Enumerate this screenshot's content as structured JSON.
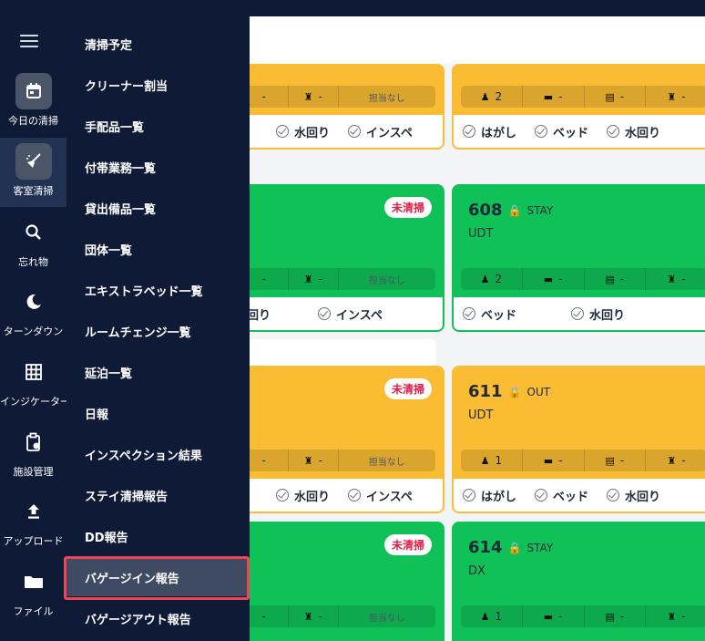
{
  "rail": {
    "items": [
      {
        "label": "今日の清掃",
        "icon": "calendar-icon"
      },
      {
        "label": "客室清掃",
        "icon": "broom-icon"
      },
      {
        "label": "忘れ物",
        "icon": "search-icon"
      },
      {
        "label": "ターンダウン",
        "icon": "moon-icon"
      },
      {
        "label": "インジケーター",
        "icon": "grid-icon"
      },
      {
        "label": "施設管理",
        "icon": "clipboard-icon"
      },
      {
        "label": "アップロード",
        "icon": "upload-icon"
      },
      {
        "label": "ファイル",
        "icon": "folder-icon"
      }
    ]
  },
  "drawer": {
    "items": [
      "清掃予定",
      "クリーナー割当",
      "手配品一覧",
      "付帯業務一覧",
      "貸出備品一覧",
      "団体一覧",
      "エキストラベッド一覧",
      "ルームチェンジ一覧",
      "延泊一覧",
      "日報",
      "インスペクション結果",
      "ステイ清掃報告",
      "DD報告",
      "バゲージイン報告",
      "バゲージアウト報告"
    ],
    "active_index": 13
  },
  "cards": {
    "dash": "-",
    "unassigned": "担当なし",
    "uncleaned": "未清掃",
    "check_hagashi": "はがし",
    "check_bed": "ベッド",
    "check_water": "水回り",
    "check_water_partial": "回り",
    "check_inspect": "インスペ",
    "right": [
      {
        "room": "608",
        "status": "STAY",
        "code": "UDT",
        "guests": "2"
      },
      {
        "room": "611",
        "status": "OUT",
        "code": "UDT",
        "guests": "1"
      },
      {
        "room": "614",
        "status": "STAY",
        "code": "DX",
        "guests": "1"
      }
    ],
    "top_right_guests": "2"
  },
  "colors": {
    "navy": "#0f1b36",
    "orange": "#f9bc33",
    "green": "#0fc157",
    "red_badge": "#e11d48",
    "highlight": "#ef4452"
  }
}
